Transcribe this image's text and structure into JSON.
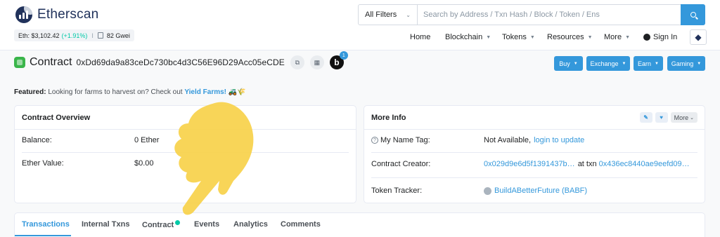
{
  "header": {
    "logo_text": "Etherscan",
    "eth_price": "Eth: $3,102.42",
    "eth_change": "(+1.91%)",
    "separator": "I",
    "gas": "82 Gwei",
    "search": {
      "filter": "All Filters",
      "placeholder": "Search by Address / Txn Hash / Block / Token / Ens"
    },
    "nav": {
      "home": "Home",
      "blockchain": "Blockchain",
      "tokens": "Tokens",
      "resources": "Resources",
      "more": "More",
      "sign_in": "Sign In"
    },
    "eth_logo_glyph": "◆"
  },
  "contract": {
    "title": "Contract",
    "address": "0xDd69da9a83ceDc730bc4d3C56E96D29Acc05eCDE",
    "badge_letter": "b",
    "badge_count": "1",
    "copy_glyph": "⧉",
    "qr_glyph": "▦"
  },
  "actions": {
    "buy": "Buy",
    "exchange": "Exchange",
    "earn": "Earn",
    "gaming": "Gaming"
  },
  "featured": {
    "label": "Featured:",
    "text": "Looking for farms to harvest on? Check out",
    "link": "Yield Farms!",
    "emoji": "🚜🌾"
  },
  "overview": {
    "title": "Contract Overview",
    "balance_label": "Balance:",
    "balance_value": "0 Ether",
    "ether_value_label": "Ether Value:",
    "ether_value": "$0.00"
  },
  "more_info": {
    "title": "More Info",
    "more_label": "More",
    "name_tag_label": "My Name Tag:",
    "name_tag_value": "Not Available,",
    "name_tag_link": "login to update",
    "creator_label": "Contract Creator:",
    "creator_address": "0x029d9e6d5f1391437b…",
    "creator_at": "at txn",
    "creator_txn": "0x436ec8440ae9eefd09…",
    "tracker_label": "Token Tracker:",
    "tracker_value": "BuildABetterFuture (BABF)"
  },
  "tabs": [
    {
      "label": "Transactions"
    },
    {
      "label": "Internal Txns"
    },
    {
      "label": "Contract"
    },
    {
      "label": "Events"
    },
    {
      "label": "Analytics"
    },
    {
      "label": "Comments"
    }
  ],
  "colors": {
    "accent": "#3498db",
    "brand": "#21325b",
    "positive": "#00c9a7",
    "contract_icon": "#3ab54a",
    "hand_overlay": "#f7d046"
  }
}
